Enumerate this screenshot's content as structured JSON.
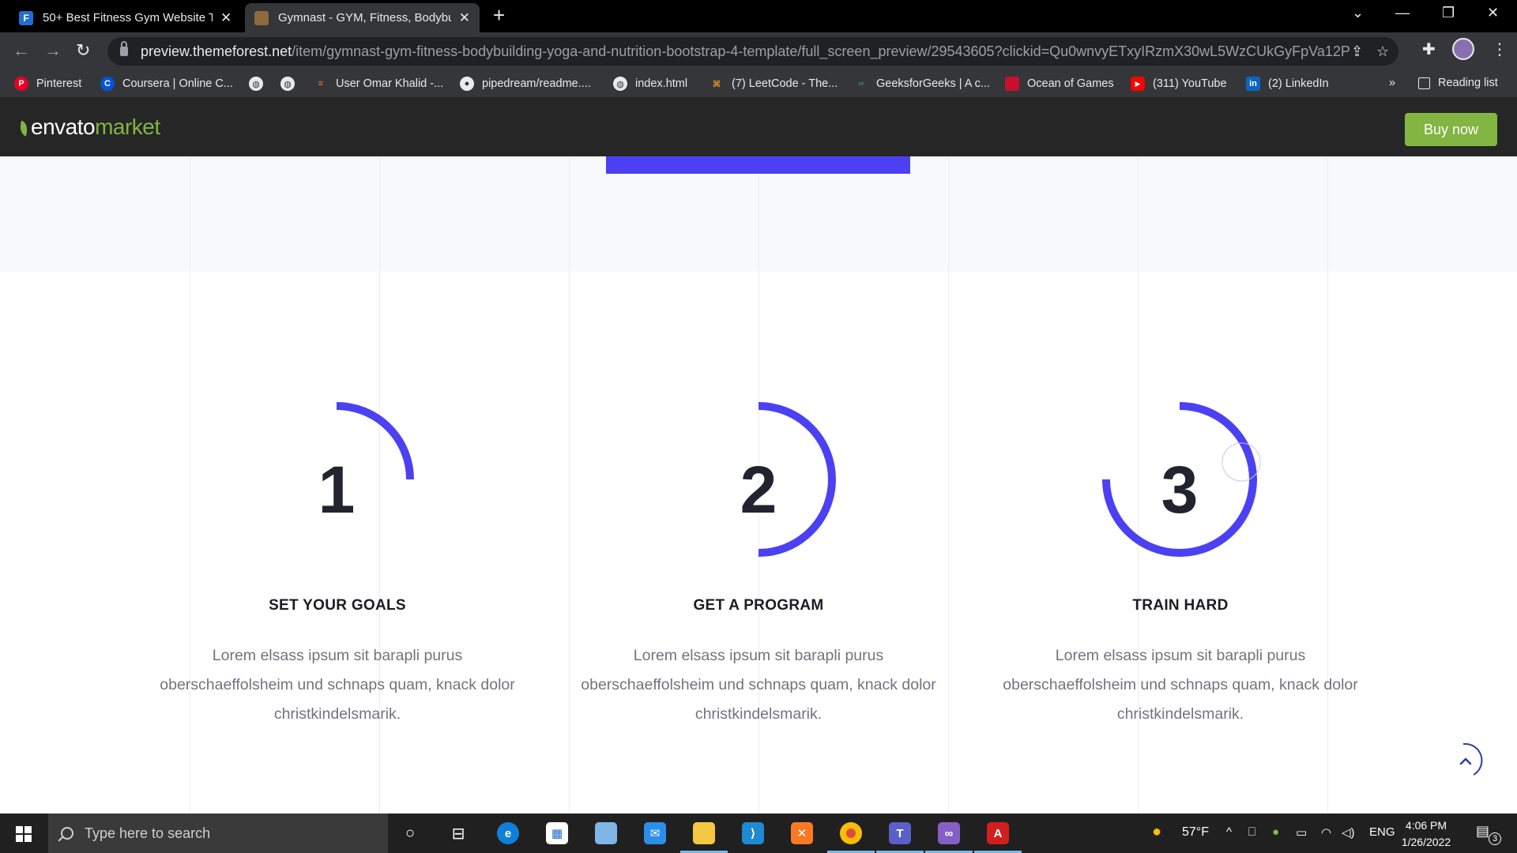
{
  "browser": {
    "tabs": [
      {
        "title": "50+ Best Fitness Gym Website Te",
        "icon": "F",
        "icon_color": "#1f6fd1"
      },
      {
        "title": "Gymnast - GYM, Fitness, Bodybui",
        "icon": "",
        "icon_color": "#8b6a3b"
      }
    ],
    "url_host": "preview.themeforest.net",
    "url_path": "/item/gymnast-gym-fitness-bodybuilding-yoga-and-nutrition-bootstrap-4-template/full_screen_preview/29543605?clickid=Qu0wnvyETxyIRzmX30wL5WzCUkGyFpVa12Pm...",
    "bookmarks": [
      {
        "label": "Pinterest",
        "icon": "P",
        "color": "#e60023"
      },
      {
        "label": "Coursera | Online C...",
        "icon": "C",
        "color": "#0056d2"
      },
      {
        "label": "",
        "icon": "",
        "color": "#ffffff"
      },
      {
        "label": "",
        "icon": "",
        "color": "#ffffff"
      },
      {
        "label": "User Omar Khalid -...",
        "icon": "",
        "color": "#f48024"
      },
      {
        "label": "pipedream/readme....",
        "icon": "",
        "color": "#ffffff"
      },
      {
        "label": "index.html",
        "icon": "",
        "color": "#ffffff"
      },
      {
        "label": "(7) LeetCode - The...",
        "icon": "",
        "color": "#f89f1b"
      },
      {
        "label": "GeeksforGeeks | A c...",
        "icon": "",
        "color": "#2f8d46"
      },
      {
        "label": "Ocean of Games",
        "icon": "",
        "color": "#c8102e"
      },
      {
        "label": "(311) YouTube",
        "icon": "▶",
        "color": "#ff0000"
      },
      {
        "label": "(2) LinkedIn",
        "icon": "in",
        "color": "#0a66c2"
      }
    ],
    "overflow": "»",
    "reading_list": "Reading list"
  },
  "envato": {
    "logo_a": "envato",
    "logo_b": "market",
    "buy_label": "Buy now"
  },
  "steps": [
    {
      "number": "1",
      "progress": 0.25,
      "title": "SET YOUR GOALS",
      "desc": [
        "Lorem elsass ipsum sit barapli purus",
        "oberschaeffolsheim und schnaps quam, knack dolor",
        "christkindelsmarik."
      ]
    },
    {
      "number": "2",
      "progress": 0.5,
      "title": "GET A PROGRAM",
      "desc": [
        "Lorem elsass ipsum sit barapli purus",
        "oberschaeffolsheim und schnaps quam, knack dolor",
        "christkindelsmarik."
      ]
    },
    {
      "number": "3",
      "progress": 0.75,
      "title": "TRAIN HARD",
      "desc": [
        "Lorem elsass ipsum sit barapli purus",
        "oberschaeffolsheim und schnaps quam, knack dolor",
        "christkindelsmarik."
      ]
    }
  ],
  "colors": {
    "accent": "#4b41f3",
    "envato_green": "#82b541"
  },
  "taskbar": {
    "search_placeholder": "Type here to search",
    "weather": "57°F",
    "language": "ENG",
    "time": "4:06 PM",
    "date": "1/26/2022",
    "notifications": "3"
  }
}
